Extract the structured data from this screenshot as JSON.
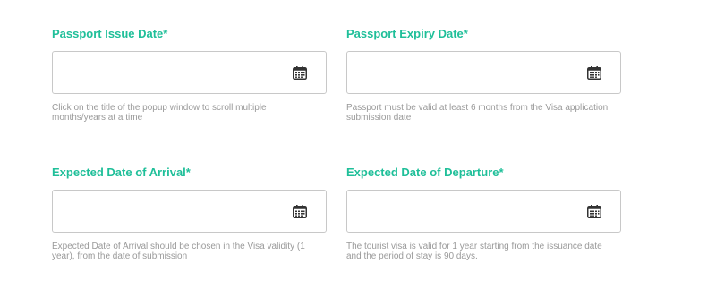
{
  "form": {
    "fields": [
      {
        "label": "Passport Issue Date*",
        "value": "",
        "icon": "calendar-icon",
        "hint": "Click on the title of the popup window to scroll multiple months/years at a time"
      },
      {
        "label": "Passport Expiry Date*",
        "value": "",
        "icon": "calendar-icon",
        "hint": "Passport must be valid at least 6 months from the Visa application submission date"
      },
      {
        "label": "Expected Date of Arrival*",
        "value": "",
        "icon": "calendar-icon",
        "hint": "Expected Date of Arrival should be chosen in the Visa validity (1 year), from the date of submission"
      },
      {
        "label": "Expected Date of Departure*",
        "value": "",
        "icon": "calendar-icon",
        "hint": "The tourist visa is valid for 1 year starting from the issuance date and the period of stay is 90 days."
      }
    ]
  },
  "colors": {
    "label_accent": "#1fbf99",
    "hint_text": "#999999",
    "input_border": "#c8c8c8",
    "icon": "#333333"
  }
}
